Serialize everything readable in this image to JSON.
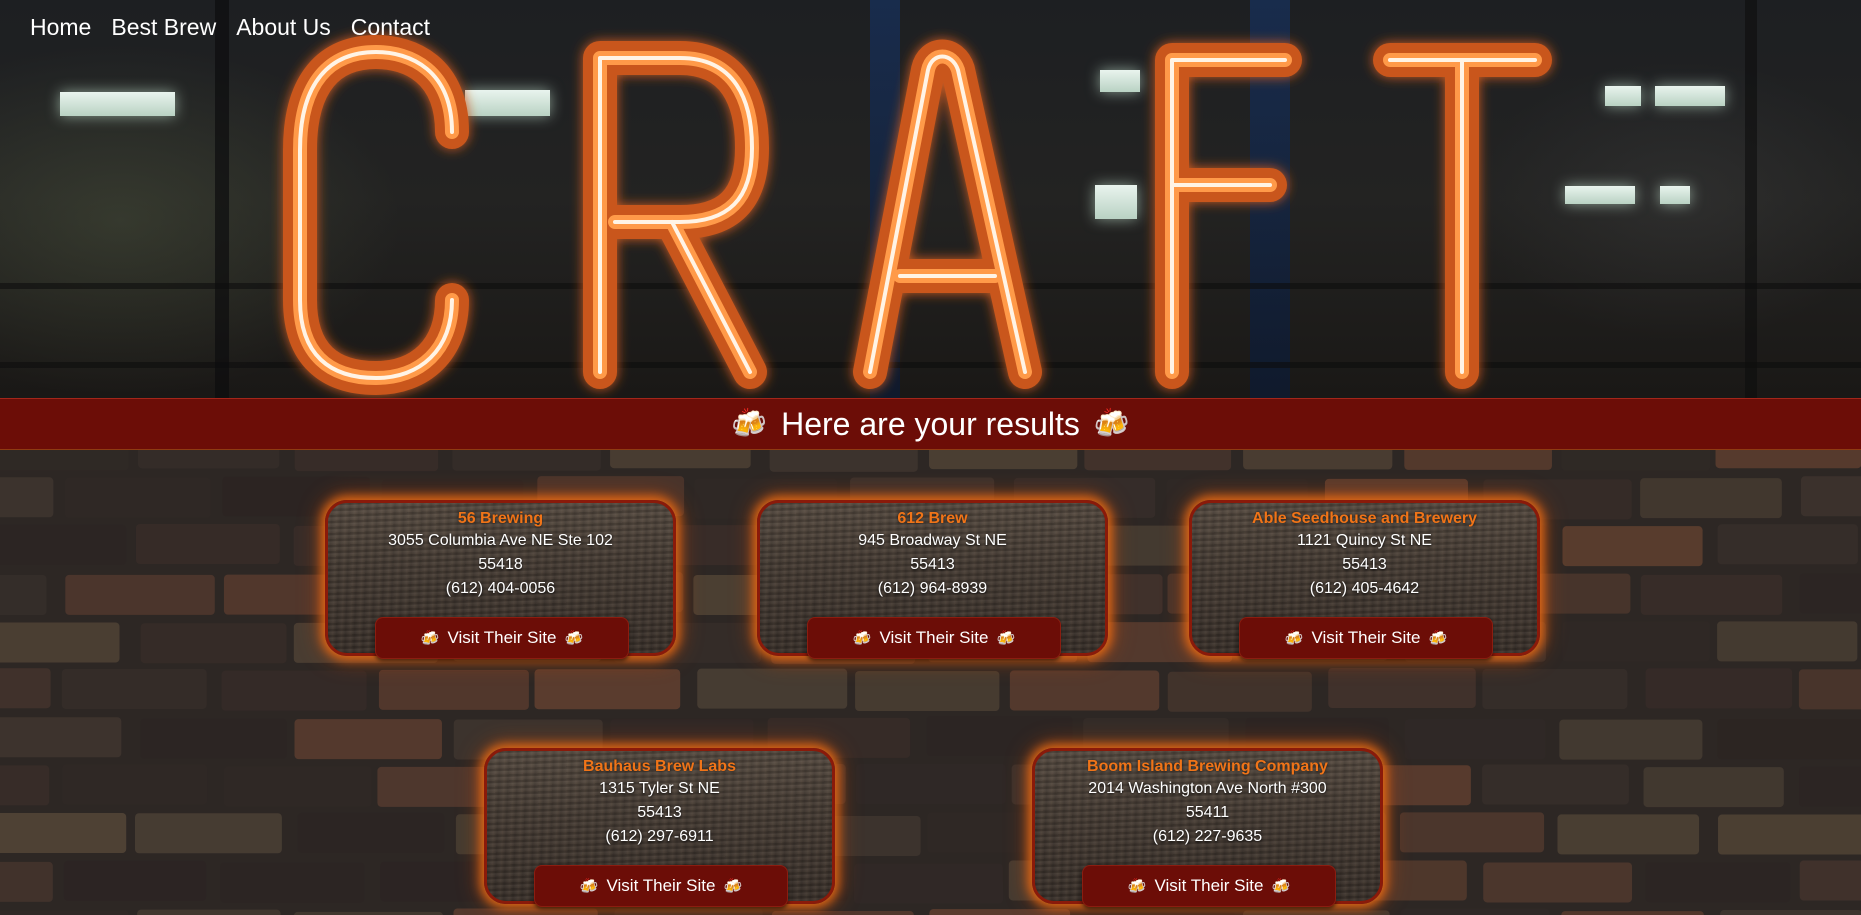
{
  "nav": {
    "items": [
      "Home",
      "Best Brew",
      "About Us",
      "Contact"
    ]
  },
  "hero": {
    "sign_text": "CRAFT",
    "neon_color": "#ff8a2a"
  },
  "results": {
    "heading": "Here are your results",
    "icon": "beer-mugs-icon",
    "icon_glyph": "🍻"
  },
  "colors": {
    "banner": "#6c0d07",
    "accent": "#f07418",
    "glow": "#f06e14"
  },
  "breweries": [
    {
      "name": "56 Brewing",
      "address": "3055 Columbia Ave NE Ste 102",
      "zip": "55418",
      "phone": "(612) 404-0056",
      "button": "Visit Their Site"
    },
    {
      "name": "612 Brew",
      "address": "945 Broadway St NE",
      "zip": "55413",
      "phone": "(612) 964-8939",
      "button": "Visit Their Site"
    },
    {
      "name": "Able Seedhouse and Brewery",
      "address": "1121 Quincy St NE",
      "zip": "55413",
      "phone": "(612) 405-4642",
      "button": "Visit Their Site"
    },
    {
      "name": "Bauhaus Brew Labs",
      "address": "1315 Tyler St NE",
      "zip": "55413",
      "phone": "(612) 297-6911",
      "button": "Visit Their Site"
    },
    {
      "name": "Boom Island Brewing Company",
      "address": "2014 Washington Ave North #300",
      "zip": "55411",
      "phone": "(612) 227-9635",
      "button": "Visit Their Site"
    }
  ]
}
